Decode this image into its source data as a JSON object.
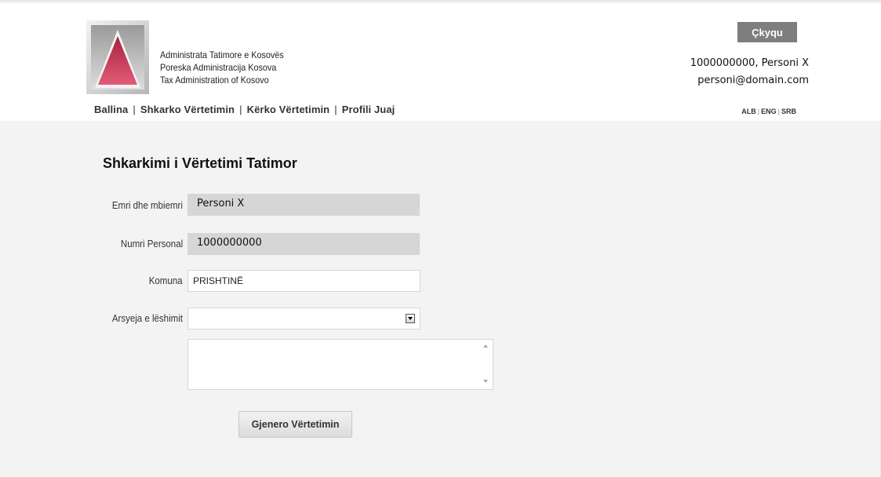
{
  "header": {
    "org_name_sq": "Administrata Tatimore e Kosovës",
    "org_name_sr": "Poreska Administracija Kosova",
    "org_name_en": "Tax Administration of Kosovo",
    "logout_label": "Çkyqu",
    "user_id_name": "1000000000, Personi X",
    "user_email": "personi@domain.com"
  },
  "nav": {
    "items": [
      "Ballina",
      "Shkarko Vërtetimin",
      "Kërko Vërtetimin",
      "Profili Juaj"
    ],
    "separator": "|"
  },
  "languages": [
    "ALB",
    "ENG",
    "SRB"
  ],
  "form": {
    "title": "Shkarkimi i Vërtetimi Tatimor",
    "name_label": "Emri dhe mbiemri",
    "name_value": "Personi X",
    "personal_number_label": "Numri Personal",
    "personal_number_value": "1000000000",
    "municipality_label": "Komuna",
    "municipality_value": "PRISHTINË",
    "reason_label": "Arsyeja e lëshimit",
    "reason_selected": "",
    "details_value": "",
    "generate_label": "Gjenero Vërtetimin"
  },
  "colors": {
    "logo_triangle": "#c8375a",
    "logout_bg": "#7e7e7e",
    "readonly_bg": "#d6d6d6",
    "content_bg": "#f3f3f3"
  }
}
